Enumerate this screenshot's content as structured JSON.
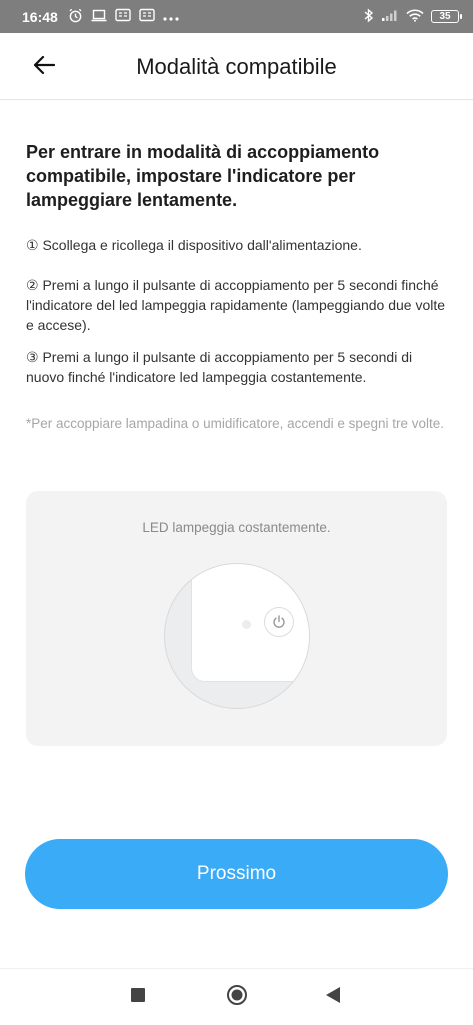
{
  "status_bar": {
    "time": "16:48",
    "battery": "35",
    "icons": [
      "alarm-icon",
      "laptop-icon",
      "notification-icon",
      "notification-icon",
      "more-icon",
      "bluetooth-icon",
      "signal-icon",
      "wifi-icon",
      "battery-icon"
    ]
  },
  "header": {
    "title": "Modalità compatibile",
    "back_icon": "arrow-left-icon"
  },
  "instructions": {
    "heading": "Per entrare in modalità di accoppiamento compatibile, impostare l'indicatore per lampeggiare lentamente.",
    "steps": [
      "① Scollega e ricollega il dispositivo dall'alimentazione.",
      "② Premi a lungo il pulsante di accoppiamento per 5 secondi finché l'indicatore del led lampeggia rapidamente (lampeggiando due volte e accese).",
      "③ Premi a lungo il pulsante di accoppiamento per 5 secondi di nuovo finché l'indicatore led lampeggia costantemente."
    ],
    "note": "*Per accoppiare lampadina o umidificatore, accendi e spegni tre volte."
  },
  "illustration": {
    "caption": "LED lampeggia costantemente."
  },
  "next_button": {
    "label": "Prossimo"
  },
  "colors": {
    "accent": "#3aabf6",
    "status_bar": "#7e7e7e",
    "card_background": "#f3f3f4"
  }
}
